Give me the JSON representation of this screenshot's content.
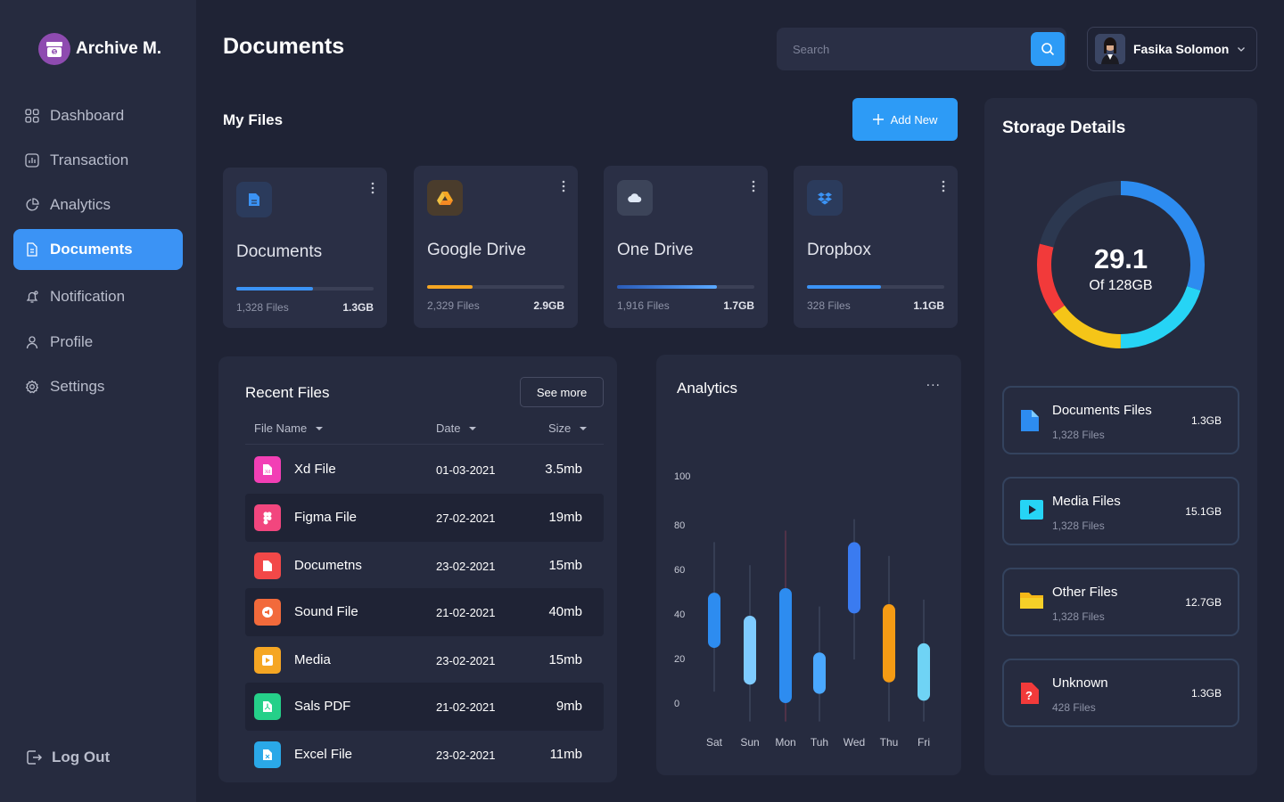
{
  "app": {
    "name": "Archive M."
  },
  "sidebar": {
    "items": [
      {
        "label": "Dashboard"
      },
      {
        "label": "Transaction"
      },
      {
        "label": "Analytics"
      },
      {
        "label": "Documents"
      },
      {
        "label": "Notification"
      },
      {
        "label": "Profile"
      },
      {
        "label": "Settings"
      }
    ],
    "active": "Documents",
    "logout": "Log Out"
  },
  "header": {
    "title": "Documents",
    "search_placeholder": "Search",
    "user_name": "Fasika Solomon"
  },
  "my_files": {
    "title": "My Files",
    "add_label": "Add New",
    "cards": [
      {
        "name": "Documents",
        "files": "1,328 Files",
        "size": "1.3GB",
        "progress": 0.56,
        "color": "#3b93f5",
        "icon": "document-icon"
      },
      {
        "name": "Google Drive",
        "files": "2,329 Files",
        "size": "2.9GB",
        "progress": 0.33,
        "color": "#f5a623",
        "icon": "google-drive-icon"
      },
      {
        "name": "One Drive",
        "files": "1,916 Files",
        "size": "1.7GB",
        "progress": 0.73,
        "color": "#3b93f5",
        "icon": "cloud-icon"
      },
      {
        "name": "Dropbox",
        "files": "328 Files",
        "size": "1.1GB",
        "progress": 0.54,
        "color": "#3b93f5",
        "icon": "dropbox-icon"
      }
    ]
  },
  "recent": {
    "title": "Recent Files",
    "see_more": "See more",
    "columns": [
      "File Name",
      "Date",
      "Size"
    ],
    "rows": [
      {
        "name": "Xd File",
        "date": "01-03-2021",
        "size": "3.5mb",
        "color": "#f23fb5",
        "icon": "xd-file-icon"
      },
      {
        "name": "Figma File",
        "date": "27-02-2021",
        "size": "19mb",
        "color": "#f2467e",
        "icon": "figma-icon"
      },
      {
        "name": "Documetns",
        "date": "23-02-2021",
        "size": "15mb",
        "color": "#f24848",
        "icon": "document-icon"
      },
      {
        "name": "Sound File",
        "date": "21-02-2021",
        "size": "40mb",
        "color": "#f26a3b",
        "icon": "sound-icon"
      },
      {
        "name": "Media",
        "date": "23-02-2021",
        "size": "15mb",
        "color": "#f5a623",
        "icon": "media-icon"
      },
      {
        "name": "Sals PDF",
        "date": "21-02-2021",
        "size": "9mb",
        "color": "#25d089",
        "icon": "pdf-icon"
      },
      {
        "name": "Excel File",
        "date": "23-02-2021",
        "size": "11mb",
        "color": "#2aa8e8",
        "icon": "excel-icon"
      }
    ]
  },
  "analytics": {
    "title": "Analytics",
    "menu": "..."
  },
  "chart_data": {
    "type": "candlestick",
    "categories": [
      "Sat",
      "Sun",
      "Mon",
      "Tuh",
      "Wed",
      "Thu",
      "Fri"
    ],
    "y_ticks": [
      100,
      80,
      60,
      40,
      20,
      0
    ],
    "ylim": [
      0,
      100
    ],
    "series": [
      {
        "low": 5,
        "high": 70,
        "open": 24,
        "close": 48,
        "color": "#2d8cf0"
      },
      {
        "low": -8,
        "high": 60,
        "open": 8,
        "close": 38,
        "color": "#7ecbff"
      },
      {
        "low": -8,
        "high": 75,
        "open": 0,
        "close": 50,
        "color": "#2d8cf0"
      },
      {
        "low": -8,
        "high": 42,
        "open": 4,
        "close": 22,
        "color": "#4aa8ff"
      },
      {
        "low": 19,
        "high": 80,
        "open": 39,
        "close": 70,
        "color": "#3a7bf0"
      },
      {
        "low": -8,
        "high": 64,
        "open": 9,
        "close": 43,
        "color": "#f59b14"
      },
      {
        "low": -8,
        "high": 45,
        "open": 1,
        "close": 26,
        "color": "#6fd3f5"
      }
    ]
  },
  "storage": {
    "title": "Storage Details",
    "used": "29.1",
    "total": "Of 128GB",
    "donut_segments": [
      {
        "share": 0.3,
        "color": "#2d8cf0"
      },
      {
        "share": 0.2,
        "color": "#26d4f5"
      },
      {
        "share": 0.15,
        "color": "#f5c518"
      },
      {
        "share": 0.14,
        "color": "#f23a3a"
      },
      {
        "share": 0.21,
        "color": "#2c3850"
      }
    ],
    "items": [
      {
        "name": "Documents Files",
        "files": "1,328 Files",
        "size": "1.3GB",
        "icon": "document-icon"
      },
      {
        "name": "Media Files",
        "files": "1,328 Files",
        "size": "15.1GB",
        "icon": "media-icon"
      },
      {
        "name": "Other Files",
        "files": "1,328 Files",
        "size": "12.7GB",
        "icon": "folder-icon"
      },
      {
        "name": "Unknown",
        "files": "428 Files",
        "size": "1.3GB",
        "icon": "unknown-file-icon"
      }
    ]
  }
}
